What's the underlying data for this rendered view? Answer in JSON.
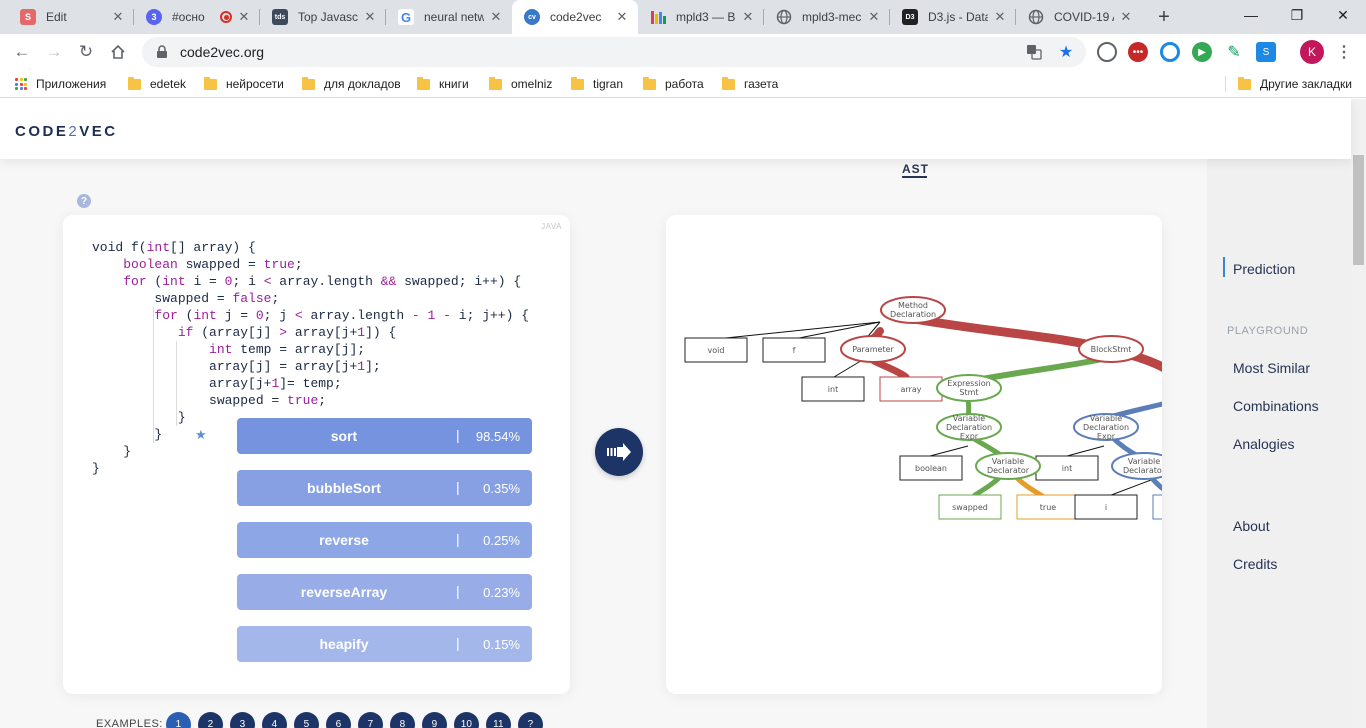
{
  "browser": {
    "tabs": [
      {
        "title": "Edit",
        "favicon": "S",
        "favicon_color": "#e46a6a"
      },
      {
        "title": "#осно",
        "favicon": "3",
        "favicon_color": "#5865f2"
      },
      {
        "title": "Top Javascr",
        "favicon": "tds",
        "favicon_color": "#3c4a5c"
      },
      {
        "title": "neural netw",
        "favicon": "G",
        "favicon_color": "#ffffff"
      },
      {
        "title": "code2vec",
        "favicon": "cv",
        "favicon_color": "#3a78c9"
      },
      {
        "title": "mpld3 — B",
        "favicon": "bars",
        "favicon_color": "#d64545"
      },
      {
        "title": "mpld3-mec",
        "favicon": "globe",
        "favicon_color": "#5f6368"
      },
      {
        "title": "D3.js - Data",
        "favicon": "D3",
        "favicon_color": "#202124"
      },
      {
        "title": "COVID-19 A",
        "favicon": "globe",
        "favicon_color": "#5f6368"
      }
    ],
    "url": "code2vec.org",
    "profile_initial": "K",
    "bookmarks": [
      "Приложения",
      "edetek",
      "нейросети",
      "для докладов",
      "книги",
      "omelniz",
      "tigran",
      "работа",
      "газета"
    ],
    "other_bookmarks": "Другие закладки"
  },
  "site": {
    "logo_a": "CODE",
    "logo_2": "2",
    "logo_b": "VEC",
    "help": "?",
    "lang": "JAVA",
    "ast_title": "AST"
  },
  "nav": {
    "prediction": "Prediction",
    "playground": "PLAYGROUND",
    "most_similar": "Most Similar",
    "combinations": "Combinations",
    "analogies": "Analogies",
    "about": "About",
    "credits": "Credits"
  },
  "predictions": [
    {
      "name": "sort",
      "pct": "98.54%",
      "color": "#7593df"
    },
    {
      "name": "bubbleSort",
      "pct": "0.35%",
      "color": "#86a0e3"
    },
    {
      "name": "reverse",
      "pct": "0.25%",
      "color": "#8da6e5"
    },
    {
      "name": "reverseArray",
      "pct": "0.23%",
      "color": "#98ade7"
    },
    {
      "name": "heapify",
      "pct": "0.15%",
      "color": "#a4b7ea"
    }
  ],
  "ast_nodes": {
    "method_declaration": [
      "Method",
      "Declaration"
    ],
    "void": "void",
    "f": "f",
    "parameter": "Parameter",
    "block_stmt": "BlockStmt",
    "int": "int",
    "array": "array",
    "expression_stmt": [
      "Expression",
      "Stmt"
    ],
    "var_decl_expr": [
      "Variable",
      "Declaration",
      "Expr"
    ],
    "boolean": "boolean",
    "var_declarator": [
      "Variable",
      "Declarator"
    ],
    "swapped": "swapped",
    "true": "true",
    "i": "i"
  },
  "examples": {
    "label": "EXAMPLES:",
    "items": [
      "1",
      "2",
      "3",
      "4",
      "5",
      "6",
      "7",
      "8",
      "9",
      "10",
      "11",
      "?"
    ]
  },
  "colors": {
    "red_path": "#b94545",
    "green_path": "#6aa84f",
    "blue_path": "#5b7db8",
    "orange_path": "#e69c2a",
    "nav_dark": "#1d3466"
  }
}
